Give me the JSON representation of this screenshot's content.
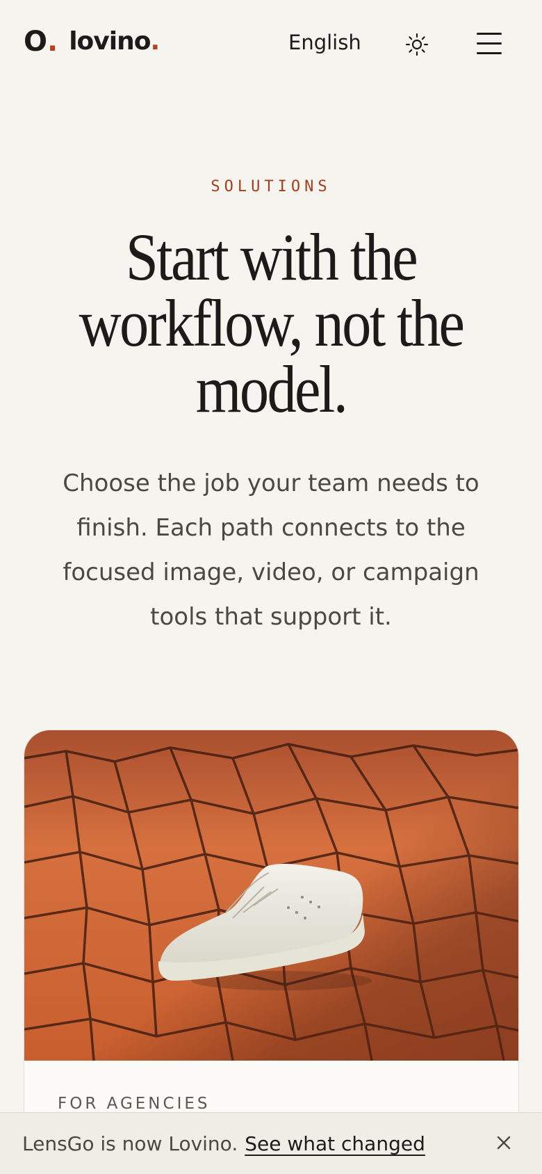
{
  "header": {
    "logo_mark": "O",
    "logo_text": "lovino",
    "logo_dot": ".",
    "language": "English",
    "theme_icon": "sun-icon",
    "menu_icon": "hamburger-menu-icon"
  },
  "hero": {
    "eyebrow": "SOLUTIONS",
    "title": "Start with the workflow, not the model.",
    "description": "Choose the job your team needs to finish. Each path connects to the focused image, video, or campaign tools that support it."
  },
  "card": {
    "image": "white sneaker floating over cracked orange desert ground",
    "label": "FOR AGENCIES"
  },
  "banner": {
    "text": "LensGo is now Lovino.",
    "link": "See what changed",
    "close_icon": "close-icon"
  },
  "colors": {
    "background": "#f6f4ef",
    "accent": "#b5421c",
    "text": "#1c1b19",
    "muted": "#4b4843"
  }
}
